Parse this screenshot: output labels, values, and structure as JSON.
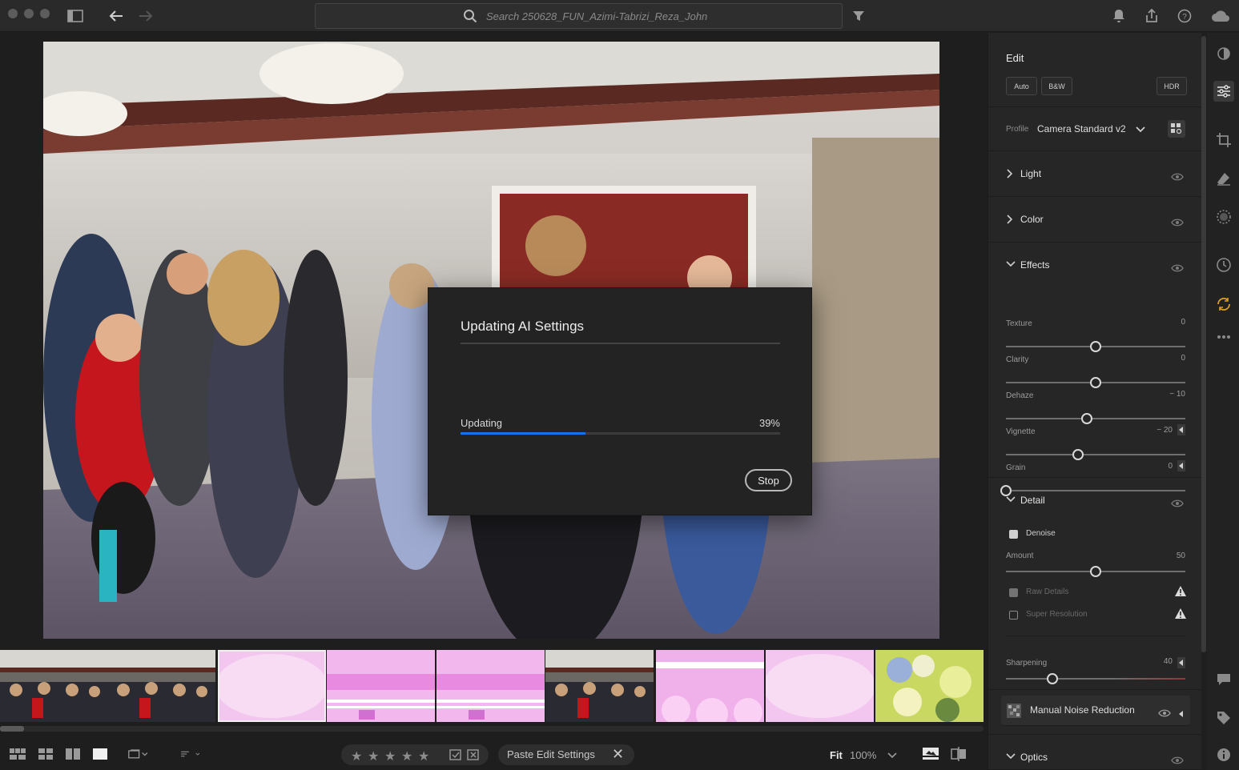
{
  "topbar": {
    "search_placeholder": "Search 250628_FUN_Azimi-Tabrizi_Reza_John",
    "icons": [
      "sidebar-toggle-icon",
      "back-arrow-icon",
      "forward-arrow-icon",
      "search-icon",
      "filter-icon",
      "notification-bell-icon",
      "share-icon",
      "help-icon",
      "cloud-icon"
    ]
  },
  "dialog": {
    "title": "Updating AI Settings",
    "progress_label": "Updating",
    "progress_value_text": "39%",
    "progress_fraction": 0.39,
    "stop_label": "Stop"
  },
  "filmstrip": {
    "thumbnails": [
      {
        "kind": "room",
        "selected": false
      },
      {
        "kind": "room",
        "selected": false
      },
      {
        "kind": "pink",
        "selected": true
      },
      {
        "kind": "pink-lines",
        "selected": false
      },
      {
        "kind": "pink-lines",
        "selected": false
      },
      {
        "kind": "room",
        "selected": false
      },
      {
        "kind": "pink-faces",
        "selected": false
      },
      {
        "kind": "pink",
        "selected": false
      },
      {
        "kind": "flowers",
        "selected": false
      }
    ]
  },
  "bottombar": {
    "paste_label": "Paste Edit Settings",
    "zoom_fit": "Fit",
    "zoom_percent": "100%",
    "stars": 5
  },
  "edit": {
    "title": "Edit",
    "auto": "Auto",
    "bw": "B&W",
    "hdr": "HDR",
    "profile_label": "Profile",
    "profile_value": "Camera Standard v2"
  },
  "sections": {
    "light": "Light",
    "color": "Color",
    "effects": "Effects",
    "detail": "Detail",
    "optics": "Optics"
  },
  "effects_sliders": [
    {
      "label": "Texture",
      "value": "0",
      "pos": 0.5
    },
    {
      "label": "Clarity",
      "value": "0",
      "pos": 0.5
    },
    {
      "label": "Dehaze",
      "value": "− 10",
      "pos": 0.45
    },
    {
      "label": "Vignette",
      "value": "− 20",
      "pos": 0.4
    },
    {
      "label": "Grain",
      "value": "0",
      "pos": 0.0
    }
  ],
  "detail": {
    "denoise_label": "Denoise",
    "amount_label": "Amount",
    "amount_value": "50",
    "amount_pos": 0.5,
    "raw_details": "Raw Details",
    "super_resolution": "Super Resolution",
    "sharpening_label": "Sharpening",
    "sharpening_value": "40",
    "sharpening_pos": 0.26,
    "manual_nr": "Manual Noise Reduction"
  },
  "colors": {
    "accent": "#1473e6",
    "panel_bg": "#262626"
  }
}
